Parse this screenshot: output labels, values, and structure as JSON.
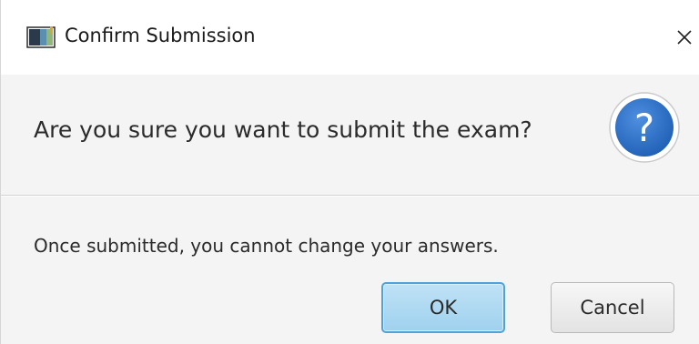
{
  "window": {
    "title": "Confirm Submission",
    "app_icon": "java-app-icon",
    "close_icon": "close-icon"
  },
  "header": {
    "text": "Are you sure you want to submit the exam?",
    "icon": "question-icon",
    "icon_color": "#2f6fc4"
  },
  "content": {
    "text": "Once submitted, you cannot change your answers."
  },
  "buttons": {
    "ok_label": "OK",
    "cancel_label": "Cancel",
    "ok_color": "#a9d6f1"
  }
}
